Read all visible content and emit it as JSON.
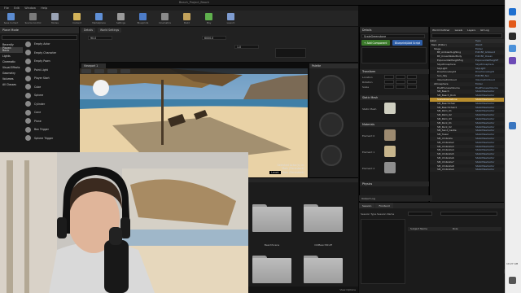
{
  "window": {
    "title": "Beach_Project_Beach"
  },
  "menu": [
    "File",
    "Edit",
    "Window",
    "Help"
  ],
  "toolbar": [
    {
      "label": "Save Current",
      "icon": "save-icon",
      "color": "#5b8bd0"
    },
    {
      "label": "Source Control",
      "icon": "source-control-icon",
      "color": "#7a7a7a"
    },
    {
      "label": "Modes",
      "icon": "modes-icon",
      "color": "#9aa3b5"
    },
    {
      "label": "Content",
      "icon": "content-icon",
      "color": "#d3b35a"
    },
    {
      "label": "Marketplace",
      "icon": "marketplace-icon",
      "color": "#5f8fd6"
    },
    {
      "label": "Settings",
      "icon": "settings-icon",
      "color": "#9a9a9a"
    },
    {
      "label": "Blueprints",
      "icon": "blueprints-icon",
      "color": "#4d7cc7"
    },
    {
      "label": "Cinematics",
      "icon": "cinematics-icon",
      "color": "#8a8a8a"
    },
    {
      "label": "Build",
      "icon": "build-icon",
      "color": "#c2a25b"
    },
    {
      "label": "Play",
      "icon": "play-icon",
      "color": "#5fb04d"
    },
    {
      "label": "Launch",
      "icon": "launch-icon",
      "color": "#7e9cd0"
    }
  ],
  "modes": {
    "title": "Place Mode",
    "categories": [
      "Recently Placed",
      "Basic",
      "Lights",
      "Cinematic",
      "Visual Effects",
      "Geometry",
      "Volumes",
      "All Classes"
    ],
    "selected_category": "Basic",
    "items": [
      "Empty Actor",
      "Empty Character",
      "Empty Pawn",
      "Point Light",
      "Player Start",
      "Cube",
      "Sphere",
      "Cylinder",
      "Cone",
      "Plane",
      "Box Trigger",
      "Sphere Trigger"
    ]
  },
  "top_fields": {
    "tab1": "Details",
    "tab2": "World Settings",
    "v1": "90.0",
    "v2": "6000.0",
    "v3": "1.0"
  },
  "viewport": {
    "tab": "Viewport 1",
    "label_line1": "Selected Actor(s) in:",
    "label_line2": "Main (Persistent)",
    "level_label": "Level:",
    "level_value": "Main (Persistent)"
  },
  "mat_panel": {
    "title": "Palette"
  },
  "details": {
    "title": "Details",
    "actor_name": "ScaleGreenstone",
    "add_component": "+ Add Component",
    "blueprint_button": "Blueprint/Add Script",
    "transform": "Transform",
    "location": "Location",
    "rotation": "Rotation",
    "scale": "Scale",
    "static_mesh": "Static Mesh",
    "mesh_label": "Static Mesh",
    "materials": "Materials",
    "element0": "Element 0",
    "element1": "Element 1",
    "element2": "Element 2",
    "physics": "Physics",
    "colors": {
      "accent_green": "#3a7a2a",
      "accent_blue": "#2f5fa8"
    }
  },
  "outliner": {
    "tabs": [
      "World Outliner",
      "Levels",
      "Layers",
      "Git Log"
    ],
    "col_label": "Label",
    "col_type": "Type",
    "rows": [
      {
        "name": "Main (Editor)",
        "type": "World"
      },
      {
        "name": "Stage",
        "type": "Folder"
      },
      {
        "name": "BP_AmbientLighting",
        "type": "Edit BP_Ambient"
      },
      {
        "name": "BP_OceanWaterBody",
        "type": "Edit BP_Ocean"
      },
      {
        "name": "ExponentialHeightFog",
        "type": "ExponentialHeightF"
      },
      {
        "name": "SkyAtmosphere",
        "type": "SkyAtmosphere"
      },
      {
        "name": "SkyLight",
        "type": "SkyLight"
      },
      {
        "name": "DirectionalLight",
        "type": "DirectionalLight"
      },
      {
        "name": "Sun_Sky",
        "type": "Edit BP_Sun"
      },
      {
        "name": "VolumetricCloud",
        "type": "VolumetricCloud"
      },
      {
        "name": "Atmosphere",
        "type": "Folder"
      },
      {
        "name": "PostProcessVolume",
        "type": "PostProcessVolume"
      },
      {
        "name": "SM_Beach",
        "type": "StaticMeshActor"
      },
      {
        "name": "SM_Beach_Rock",
        "type": "StaticMeshActor"
      },
      {
        "name": "ScaleGreenstone",
        "type": "StaticMeshActor"
      },
      {
        "name": "SM_BeachChair",
        "type": "StaticMeshActor"
      },
      {
        "name": "SM_BeachChair2",
        "type": "StaticMeshActor"
      },
      {
        "name": "SM_Palm_01",
        "type": "StaticMeshActor"
      },
      {
        "name": "SM_Palm_02",
        "type": "StaticMeshActor"
      },
      {
        "name": "SM_Palm_03",
        "type": "StaticMeshActor"
      },
      {
        "name": "SM_Rock_01",
        "type": "StaticMeshActor"
      },
      {
        "name": "SM_Rock_02",
        "type": "StaticMeshActor"
      },
      {
        "name": "SM_Sand_Castle",
        "type": "StaticMeshActor"
      },
      {
        "name": "SM_Towel",
        "type": "StaticMeshActor"
      },
      {
        "name": "SM_Umbrella",
        "type": "StaticMeshActor"
      },
      {
        "name": "SM_Umbrella2",
        "type": "StaticMeshActor"
      },
      {
        "name": "SM_Umbrella3",
        "type": "StaticMeshActor"
      },
      {
        "name": "SM_Umbrella4",
        "type": "StaticMeshActor"
      },
      {
        "name": "SM_Umbrella5",
        "type": "StaticMeshActor"
      },
      {
        "name": "SM_Umbrella6",
        "type": "StaticMeshActor"
      },
      {
        "name": "SM_Umbrella7",
        "type": "StaticMeshActor"
      },
      {
        "name": "SM_Umbrella8",
        "type": "StaticMeshActor"
      },
      {
        "name": "SM_Umbrella9",
        "type": "StaticMeshActor"
      }
    ],
    "selected_index": 14,
    "footer": "31 actors (1 selected)"
  },
  "content": {
    "folders": [
      "BeachScene",
      "OldBeachStuff",
      "",
      ""
    ],
    "status": "View Options"
  },
  "data_panel": {
    "tabs": [
      "Session",
      "Frontend"
    ],
    "filter_a": "Session Type",
    "filter_b": "Session Name",
    "filter_c": "Filters",
    "col1": "Subject Name",
    "col2": "Role"
  },
  "output_log": {
    "tab": "Output Log",
    "text": "0 Errors, 0 Warnings"
  },
  "taskbar": {
    "time": "10:27 AM"
  }
}
